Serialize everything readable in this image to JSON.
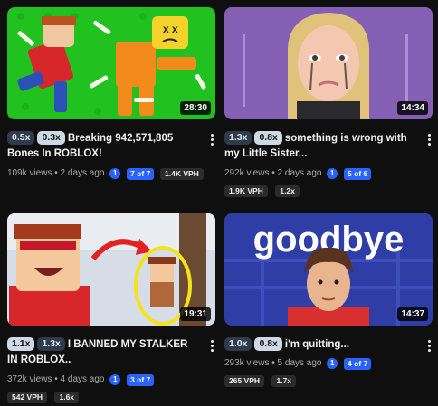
{
  "videos": [
    {
      "duration": "28:30",
      "speed_a": "0.5x",
      "speed_b": "0.3x",
      "title": "Breaking 942,571,805 Bones In ROBLOX!",
      "views": "109k views",
      "age": "2 days ago",
      "info_icon": "1",
      "position": "7 of 7",
      "tags": [
        "1.4K VPH"
      ]
    },
    {
      "duration": "14:34",
      "speed_a": "1.3x",
      "speed_b": "0.8x",
      "title": "something is wrong with my Little Sister...",
      "views": "292k views",
      "age": "2 days ago",
      "info_icon": "1",
      "position": "5 of 6",
      "tags": [
        "1.9K VPH",
        "1.2x"
      ]
    },
    {
      "duration": "19:31",
      "speed_a": "1.1x",
      "speed_b": "1.3x",
      "title": "I BANNED MY STALKER IN ROBLOX..",
      "views": "372k views",
      "age": "4 days ago",
      "info_icon": "1",
      "position": "3 of 7",
      "tags": [
        "542 VPH",
        "1.6x"
      ]
    },
    {
      "duration": "14:37",
      "speed_a": "1.0x",
      "speed_b": "0.8x",
      "title": "i'm quitting...",
      "views": "293k views",
      "age": "5 days ago",
      "info_icon": "1",
      "position": "4 of 7",
      "tags": [
        "265 VPH",
        "1.7x"
      ],
      "thumb_text": "goodbye"
    }
  ],
  "separator": "•",
  "colors": {
    "background": "#0f0f0f",
    "accent_blue": "#2962ff",
    "pill_dark": "#2f3b4a",
    "pill_light": "#cfd9e6"
  },
  "icons": {
    "more": "more-vert-icon"
  }
}
